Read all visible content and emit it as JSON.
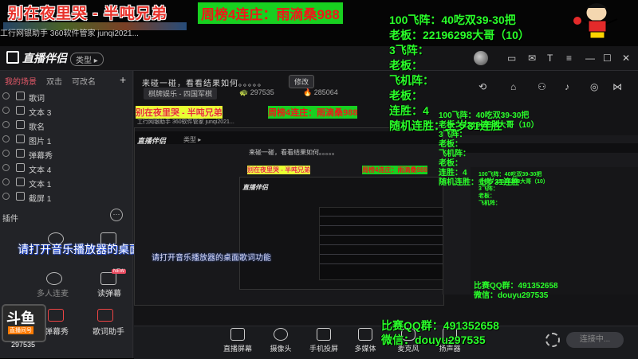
{
  "desktop": {
    "stream_title": "别在夜里哭 - 半吨兄弟",
    "shortcuts": "工行网银助手  360软件管家  junqi2021...",
    "rank_title": "周榜4连庄：雨滴桑988"
  },
  "overlay": {
    "lines": [
      "100飞阵：40吃双39-30把",
      "老板：22196298大哥（10）",
      "3飞阵：",
      "老板：",
      "飞机阵：",
      "老板：",
      "连胜：4",
      "随机连胜：上岁31连胜"
    ],
    "qq_group": "比赛QQ群：491352658",
    "wechat": "微信：douyu297535",
    "qq_group_small": "比赛QQ群：491352658",
    "wechat_small": "微信：douyu297535"
  },
  "app": {
    "logo": "直播伴侣",
    "badge": "类型 ▸",
    "scene_tabs": [
      "我的场景",
      "双击",
      "可改名"
    ],
    "sources": [
      {
        "label": "歌词"
      },
      {
        "label": "文本 3"
      },
      {
        "label": "歌名"
      },
      {
        "label": "图片 1"
      },
      {
        "label": "弹幕秀"
      },
      {
        "label": "文本 4"
      },
      {
        "label": "文本 1"
      },
      {
        "label": "截屏 1"
      }
    ],
    "tools_title": "插件",
    "tools": [
      {
        "label": "多人连麦"
      },
      {
        "label": "读弹幕"
      },
      {
        "label": "弹幕秀"
      },
      {
        "label": "歌词助手"
      }
    ],
    "lyrics_hint": "请打开音乐播放器的桌面歌词功能",
    "stage_title": "来碰一碰，看看结果如何。。。。。",
    "edit": "修改",
    "category": "棋牌娱乐 - 四国军棋",
    "stat_1": "🐢 297535",
    "stat_2": "🔥 285064",
    "douyu": "斗鱼",
    "douyu_sub": "直播间号",
    "douyu_id": "297535",
    "bottom": [
      "直播屏幕",
      "摄像头",
      "手机投屏",
      "多媒体",
      "麦克风",
      "扬声器"
    ],
    "start": "连接中..."
  }
}
